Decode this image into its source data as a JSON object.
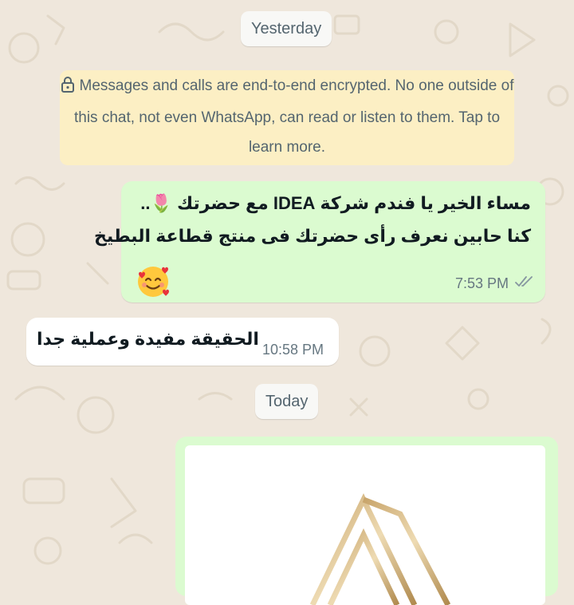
{
  "chat": {
    "date_yesterday": "Yesterday",
    "date_today": "Today",
    "encryption_notice": "Messages and calls are end-to-end encrypted. No one outside of this chat, not even WhatsApp, can read or listen to them. Tap to learn more.",
    "messages": [
      {
        "direction": "outgoing",
        "line1": "مساء الخير يا فندم شركة IDEA مع حضرتك 🌷..",
        "line2": "كنا حابين نعرف رأى حضرتك فى منتج  قطاعة البطيخ",
        "emoji": "smiling-face-with-hearts",
        "time": "7:53 PM",
        "status": "read"
      },
      {
        "direction": "incoming",
        "text": "الحقيقة مفيدة وعملية جدا",
        "time": "10:58 PM"
      },
      {
        "direction": "outgoing",
        "type": "image",
        "content": "gold-logo-image"
      }
    ]
  },
  "colors": {
    "wallpaper": "#efe7dc",
    "outgoing_bubble": "#dbfbd0",
    "incoming_bubble": "#ffffff",
    "notice_bg": "#fcefc4",
    "read_ticks": "#8696a0"
  }
}
